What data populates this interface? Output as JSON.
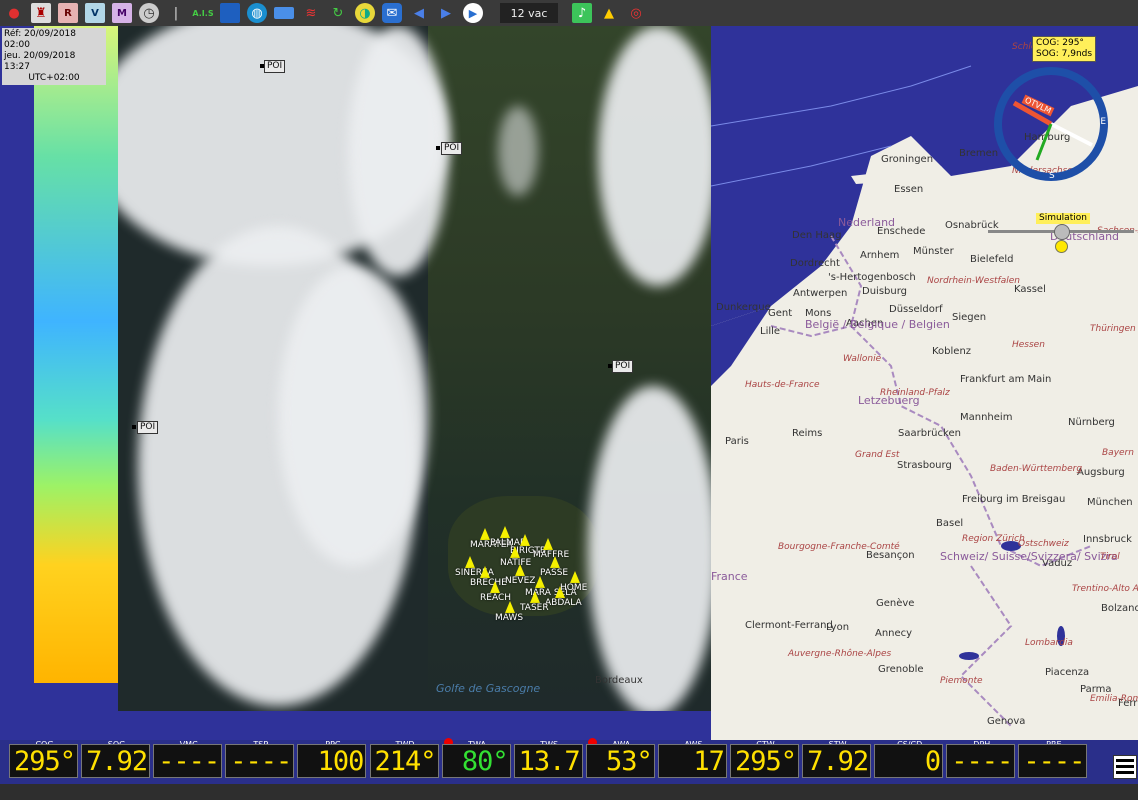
{
  "toolbar": {
    "icons": [
      "map-pin-icon",
      "lighthouse-icon",
      "r-grib-icon",
      "v-grib-icon",
      "m-grib-icon",
      "clock-icon",
      "thermometer-icon",
      "ais-icon",
      "blue-square-icon",
      "globe-icon",
      "layers-icon",
      "windsock-icon",
      "refresh-icon",
      "weather-disc-icon",
      "mail-icon",
      "previous-arrow-icon",
      "next-arrow-icon",
      "play-icon"
    ],
    "ais_label": "A.I.S",
    "vac_label": "12 vac",
    "right_icons": [
      "bell-icon",
      "warning-icon",
      "lifebuoy-icon"
    ]
  },
  "time": {
    "ref": "Réf: 20/09/2018 02:00",
    "current": "jeu. 20/09/2018 13:27",
    "tz": "UTC+02:00"
  },
  "poi_label": "POI",
  "compass": {
    "cog": "COG: 295°",
    "sog": "SOG: 7,9nds",
    "boat_label": "OTVLM",
    "east": "E",
    "south": "S"
  },
  "simulation": {
    "label": "Simulation",
    "position": 0.5
  },
  "cities": [
    "Groningen",
    "Bremen",
    "Hamburg",
    "Essen",
    "Enschede",
    "Osnabrück",
    "Den Haag",
    "Arnhem",
    "Münster",
    "Bielefeld",
    "Dordrecht",
    "'s-Hertogenbosch",
    "Antwerpen",
    "Duisburg",
    "Kassel",
    "Dunkerque",
    "Gent",
    "Mons",
    "Aachen",
    "Düsseldorf",
    "Siegen",
    "Lille",
    "Koblenz",
    "Frankfurt am Main",
    "Paris",
    "Reims",
    "Saarbrücken",
    "Mannheim",
    "Nürnberg",
    "Strasbourg",
    "Augsburg",
    "Freiburg im Breisgau",
    "München",
    "Basel",
    "Besançon",
    "Vaduz",
    "Innsbruck",
    "Genève",
    "Lyon",
    "Annecy",
    "Clermont-Ferrand",
    "Grenoble",
    "Bolzano",
    "Piacenza",
    "Bordeaux",
    "Genova",
    "Parma",
    "Ferrara"
  ],
  "countries": [
    "Nederland",
    "Deutschland",
    "België / Belgique / Belgien",
    "Letzebuerg",
    "Schweiz/ Suisse/Svizzera/ Svizra",
    "France"
  ],
  "regions": [
    "Schleswig-Holstein",
    "Niedersachsen",
    "Sachsen-Anhalt",
    "Nordrhein-Westfalen",
    "Hessen",
    "Thüringen",
    "Wallonie",
    "Hauts-de-France",
    "Grand Est",
    "Rheinland-Pfalz",
    "Baden-Württemberg",
    "Bayern",
    "Bourgogne-Franche-Comté",
    "Auvergne-Rhône-Alpes",
    "Trentino-Alto Adige/Südtirol",
    "Lombardia",
    "Emilia-Romagna",
    "Piemonte",
    "Tirol",
    "Ostschweiz",
    "Region Zürich"
  ],
  "sea_label": "Golfe de Gascogne",
  "boats": [
    "MARATEA",
    "PALMAR",
    "BIRIGTB",
    "MAFFRE",
    "SINEREA",
    "BRECHE",
    "NEVEZ",
    "MARA SELA",
    "ABDALA",
    "HOME",
    "NATIFE",
    "REACH",
    "TASER",
    "PASSE",
    "MAWS"
  ],
  "instruments": [
    {
      "label": "COG",
      "value": "295°",
      "color": "yellow"
    },
    {
      "label": "SOG",
      "value": "7.92",
      "color": "yellow"
    },
    {
      "label": "VMC",
      "value": "----",
      "color": "yellow"
    },
    {
      "label": "TSP",
      "value": "----",
      "color": "yellow"
    },
    {
      "label": "PPC",
      "value": "100",
      "color": "yellow"
    },
    {
      "label": "TWD",
      "value": "214°",
      "color": "yellow"
    },
    {
      "label": "TWA",
      "value": "80°",
      "color": "green",
      "dot": true
    },
    {
      "label": "TWS",
      "value": "13.7",
      "color": "yellow"
    },
    {
      "label": "AWA",
      "value": "53°",
      "color": "yellow",
      "dot": true
    },
    {
      "label": "AWS",
      "value": "17",
      "color": "yellow"
    },
    {
      "label": "CTW",
      "value": "295°",
      "color": "yellow"
    },
    {
      "label": "STW",
      "value": "7.92",
      "color": "yellow"
    },
    {
      "label": "CS/CD",
      "value": "0",
      "color": "yellow"
    },
    {
      "label": "DPH",
      "value": "----",
      "color": "yellow"
    },
    {
      "label": "PRE",
      "value": "----",
      "color": "yellow"
    }
  ],
  "colors": {
    "sea": "#2f329a",
    "land": "#f0eee6",
    "accent": "#ffe000",
    "compass": "#1e4fa8"
  }
}
